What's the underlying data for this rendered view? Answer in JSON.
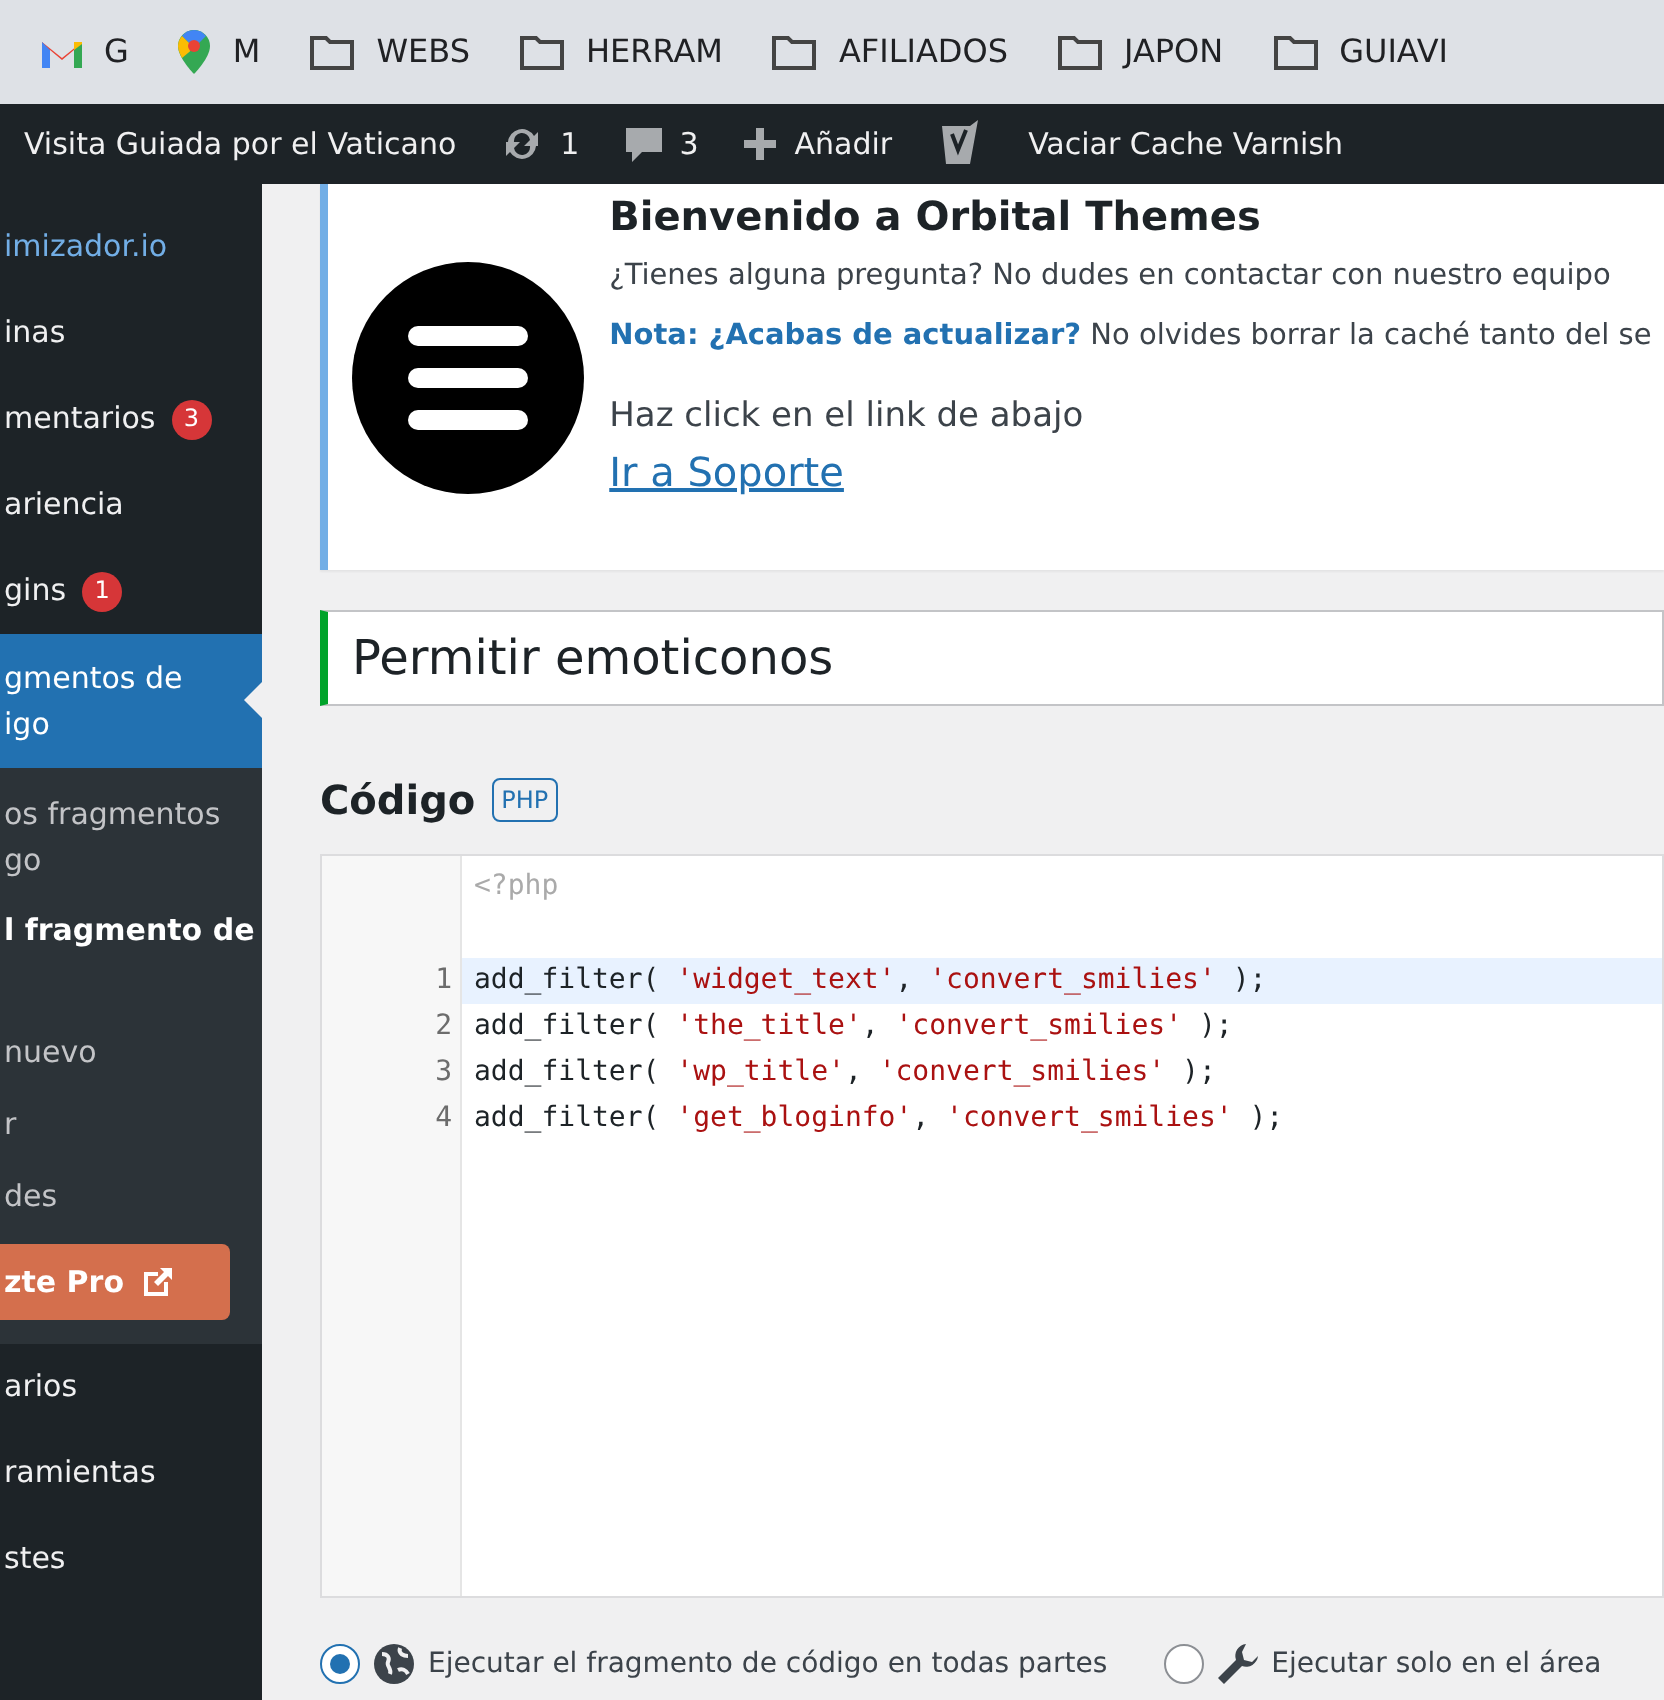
{
  "bookmarks": [
    {
      "kind": "gmail",
      "label": "G"
    },
    {
      "kind": "maps",
      "label": "M"
    },
    {
      "kind": "folder",
      "label": "WEBS"
    },
    {
      "kind": "folder",
      "label": "HERRAM"
    },
    {
      "kind": "folder",
      "label": "AFILIADOS"
    },
    {
      "kind": "folder",
      "label": "JAPON"
    },
    {
      "kind": "folder",
      "label": "GUIAVI"
    }
  ],
  "admin_bar": [
    {
      "kind": "site",
      "label": "Visita Guiada por el Vaticano"
    },
    {
      "kind": "updates",
      "label": "1"
    },
    {
      "kind": "comments",
      "label": "3"
    },
    {
      "kind": "add",
      "label": "Añadir"
    },
    {
      "kind": "yoast"
    },
    {
      "kind": "text",
      "label": "Vaciar Cache Varnish"
    }
  ],
  "sidebar": {
    "items": [
      {
        "label": "imizador.io",
        "kind": "plugin"
      },
      {
        "label": "inas",
        "kind": "top"
      },
      {
        "label": "mentarios",
        "kind": "top",
        "badge": "3"
      },
      {
        "label": "ariencia",
        "kind": "top"
      },
      {
        "label": "gins",
        "kind": "top",
        "badge": "1"
      },
      {
        "label": "gmentos de\nigo",
        "kind": "top",
        "selected": true
      },
      {
        "label": "os fragmentos\ngo",
        "kind": "sub"
      },
      {
        "label": "l fragmento de",
        "kind": "sub",
        "selected": true
      },
      {
        "label": "nuevo",
        "kind": "sub"
      },
      {
        "label": "r",
        "kind": "sub"
      },
      {
        "label": "des",
        "kind": "sub"
      },
      {
        "label": "zte Pro",
        "kind": "pro"
      },
      {
        "label": "arios",
        "kind": "top"
      },
      {
        "label": "ramientas",
        "kind": "top"
      },
      {
        "label": "stes",
        "kind": "top"
      }
    ]
  },
  "notice": {
    "title": "Bienvenido a Orbital Themes",
    "text": "¿Tienes alguna pregunta? No dudes en contactar con nuestro equipo",
    "note": "**Nota: ¿Acabas de actualizar?** No olvides borrar la caché tanto del se",
    "hint": "Haz click en el link de abajo",
    "link": "Ir a Soporte"
  },
  "snippet": {
    "title": "Permitir emoticonos",
    "code_label": "Código",
    "language": "PHP",
    "prelude": "<?php",
    "lines": [
      {
        "number": "1",
        "selected": true,
        "tokens": [
          {
            "kind": "plain",
            "text": "add_filter( "
          },
          {
            "kind": "string",
            "text": "'widget_text'"
          },
          {
            "kind": "plain",
            "text": ", "
          },
          {
            "kind": "string",
            "text": "'convert_smilies'"
          },
          {
            "kind": "plain",
            "text": " );"
          }
        ]
      },
      {
        "number": "2",
        "selected": false,
        "tokens": [
          {
            "kind": "plain",
            "text": "add_filter( "
          },
          {
            "kind": "string",
            "text": "'the_title'"
          },
          {
            "kind": "plain",
            "text": ", "
          },
          {
            "kind": "string",
            "text": "'convert_smilies'"
          },
          {
            "kind": "plain",
            "text": " );"
          }
        ]
      },
      {
        "number": "3",
        "selected": false,
        "tokens": [
          {
            "kind": "plain",
            "text": "add_filter( "
          },
          {
            "kind": "string",
            "text": "'wp_title'"
          },
          {
            "kind": "plain",
            "text": ", "
          },
          {
            "kind": "string",
            "text": "'convert_smilies'"
          },
          {
            "kind": "plain",
            "text": " );"
          }
        ]
      },
      {
        "number": "4",
        "selected": false,
        "tokens": [
          {
            "kind": "plain",
            "text": "add_filter( "
          },
          {
            "kind": "string",
            "text": "'get_bloginfo'"
          },
          {
            "kind": "plain",
            "text": ", "
          },
          {
            "kind": "string",
            "text": "'convert_smilies'"
          },
          {
            "kind": "plain",
            "text": " );"
          }
        ]
      }
    ],
    "scope": [
      {
        "kind": "globe",
        "label": "Ejecutar el fragmento de código en todas partes",
        "selected": true
      },
      {
        "kind": "wrench",
        "label": "Ejecutar solo en el área",
        "selected": false
      }
    ]
  }
}
